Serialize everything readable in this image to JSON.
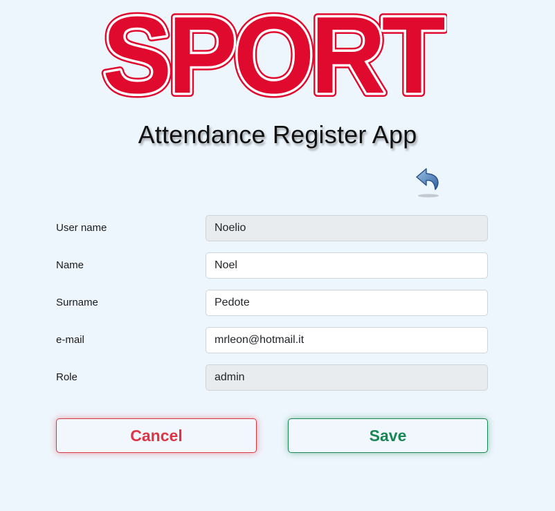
{
  "brand": {
    "logo_text": "SPORT",
    "logo_color": "#e00a2e"
  },
  "header": {
    "title": "Attendance Register App"
  },
  "form": {
    "fields": [
      {
        "label": "User name",
        "value": "Noelio",
        "readonly": true
      },
      {
        "label": "Name",
        "value": "Noel",
        "readonly": false
      },
      {
        "label": "Surname",
        "value": "Pedote",
        "readonly": false
      },
      {
        "label": "e-mail",
        "value": "mrleon@hotmail.it",
        "readonly": false
      },
      {
        "label": "Role",
        "value": "admin",
        "readonly": true
      }
    ]
  },
  "actions": {
    "back_icon": "undo-arrow-icon",
    "cancel_label": "Cancel",
    "save_label": "Save",
    "cancel_color": "#dc3545",
    "save_color": "#198754"
  }
}
